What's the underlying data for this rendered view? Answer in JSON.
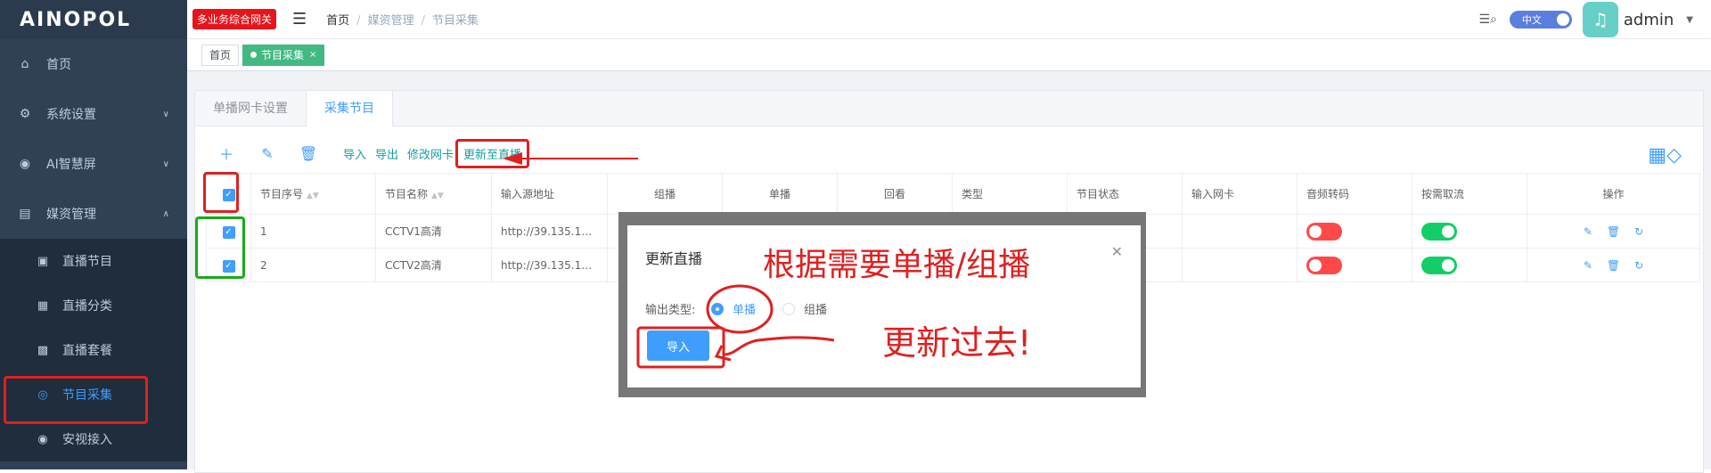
{
  "logo": "AINOPOL",
  "sidebar": {
    "items": [
      {
        "label": "首页",
        "icon": "home-icon"
      },
      {
        "label": "系统设置",
        "icon": "gear-icon"
      },
      {
        "label": "AI智慧屏",
        "icon": "ai-icon"
      },
      {
        "label": "媒资管理",
        "icon": "media-icon"
      }
    ],
    "sub_items": [
      {
        "label": "直播节目",
        "icon": "tv-icon"
      },
      {
        "label": "直播分类",
        "icon": "category-icon"
      },
      {
        "label": "直播套餐",
        "icon": "package-icon"
      },
      {
        "label": "节目采集",
        "icon": "globe-icon"
      },
      {
        "label": "安视接入",
        "icon": "camera-icon"
      }
    ]
  },
  "header": {
    "brand_button": "多业务综合网关",
    "breadcrumb": [
      "首页",
      "媒资管理",
      "节目采集"
    ],
    "lang": "中文",
    "user": "admin"
  },
  "tags": [
    "首页",
    "节目采集"
  ],
  "tabs": [
    "单播网卡设置",
    "采集节目"
  ],
  "toolbar": {
    "links": [
      "导入",
      "导出",
      "修改网卡"
    ],
    "highlight": "更新至直播"
  },
  "table": {
    "columns": [
      "节目序号",
      "节目名称",
      "输入源地址",
      "组播",
      "单播",
      "回看",
      "类型",
      "节目状态",
      "输入网卡",
      "音频转码",
      "按需取流",
      "操作"
    ],
    "rows": [
      {
        "id": "1",
        "name": "CCTV1高清",
        "url": "http://39.135.138....",
        "audio": "off",
        "ondemand": "on"
      },
      {
        "id": "2",
        "name": "CCTV2高清",
        "url": "http://39.135.138....",
        "audio": "off",
        "ondemand": "on"
      }
    ]
  },
  "dialog": {
    "title": "更新直播",
    "label": "输出类型:",
    "options": [
      "单播",
      "组播"
    ],
    "selected": "单播",
    "button": "导入"
  },
  "annotations": {
    "top": "根据需要单播/组播",
    "bottom": "更新过去!"
  },
  "colors": {
    "sidebar_bg": "#304156",
    "accent": "#409eff",
    "tag_active": "#42b983",
    "annotation_red": "#e02020",
    "annotation_green": "#1aaa1a"
  }
}
